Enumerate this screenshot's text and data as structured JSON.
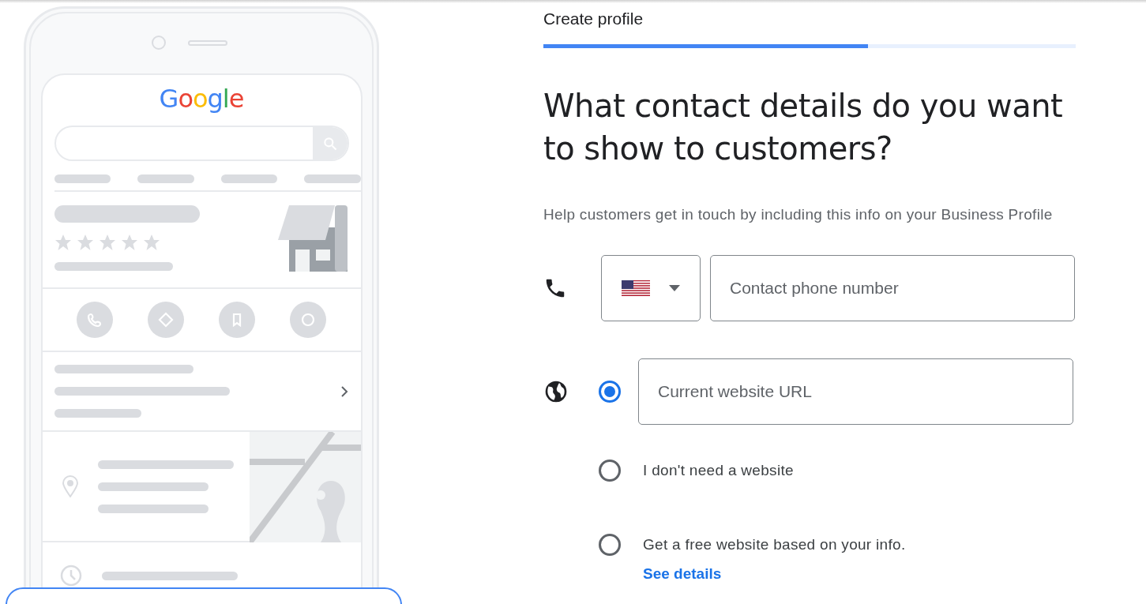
{
  "preview": {
    "logo": "Google"
  },
  "header": {
    "step_title": "Create profile",
    "progress": {
      "level": 0.61
    }
  },
  "heading": "What contact details do you want to show to customers?",
  "description": "Help customers get in touch by including this info on your Business Profile",
  "phone": {
    "placeholder": "Contact phone number"
  },
  "website": {
    "options": [
      {
        "kind": "url",
        "placeholder": "Current website URL",
        "selected": true
      },
      {
        "kind": "text",
        "label": "I don't need a website",
        "selected": false
      },
      {
        "kind": "text_link",
        "label": "Get a free website based on your info.",
        "link": "See details",
        "selected": false
      }
    ]
  }
}
